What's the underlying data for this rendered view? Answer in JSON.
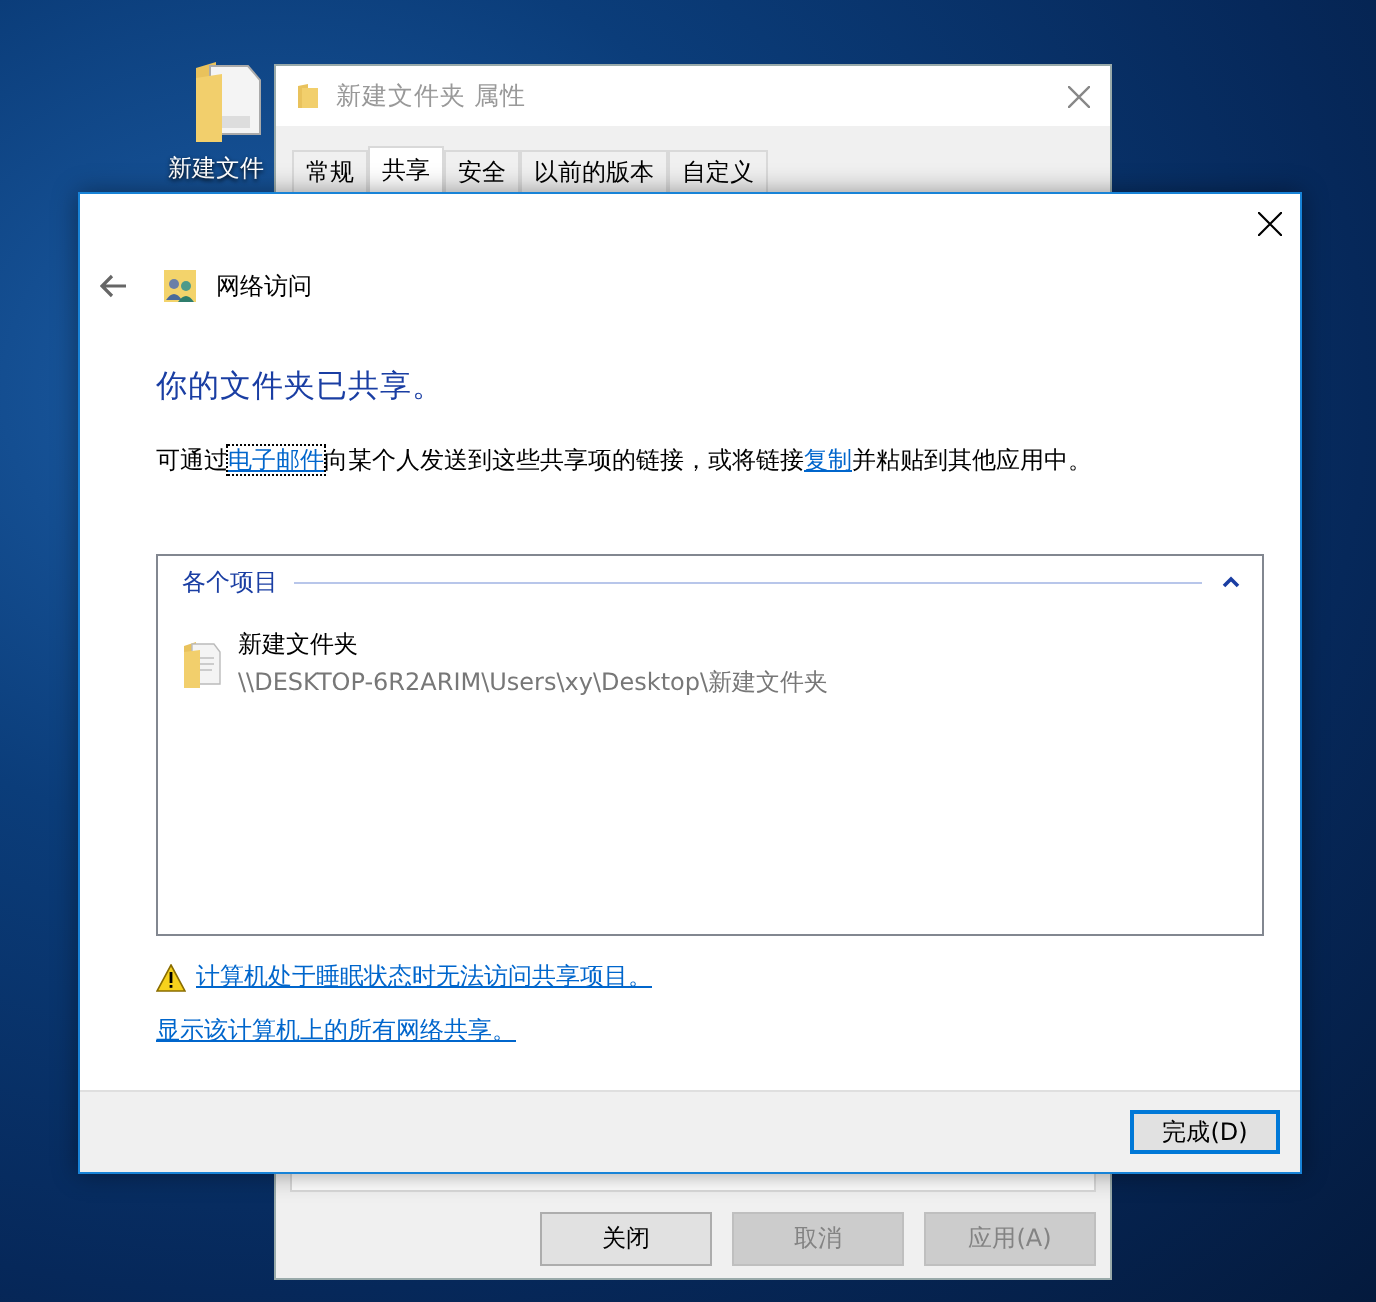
{
  "desktop_icons": [
    {
      "label": "新建文件"
    }
  ],
  "properties_window": {
    "title": "新建文件夹 属性",
    "tabs": [
      {
        "label": "常规",
        "selected": false
      },
      {
        "label": "共享",
        "selected": true
      },
      {
        "label": "安全",
        "selected": false
      },
      {
        "label": "以前的版本",
        "selected": false
      },
      {
        "label": "自定义",
        "selected": false
      }
    ],
    "buttons": [
      {
        "label": "关闭",
        "disabled": false
      },
      {
        "label": "取消",
        "disabled": true
      },
      {
        "label": "应用(A)",
        "disabled": true
      }
    ]
  },
  "sharing_dialog": {
    "title": "网络访问",
    "heading": "你的文件夹已共享。",
    "message": [
      {
        "kind": "text",
        "text": "可通过"
      },
      {
        "kind": "link",
        "text": "电子邮件",
        "focused": true
      },
      {
        "kind": "text",
        "text": "向某个人发送到这些共享项的链接，或将链接"
      },
      {
        "kind": "link",
        "text": "复制",
        "focused": false
      },
      {
        "kind": "text",
        "text": "并粘贴到其他应用中。"
      }
    ],
    "group": {
      "label": "各个项目",
      "expanded": true,
      "items": [
        {
          "name": "新建文件夹",
          "path": "\\\\DESKTOP-6R2ARIM\\Users\\xy\\Desktop\\新建文件夹"
        }
      ]
    },
    "warning_link": "计算机处于睡眠状态时无法访问共享项目。",
    "show_all_link": "显示该计算机上的所有网络共享。",
    "done_button": "完成(D)"
  }
}
